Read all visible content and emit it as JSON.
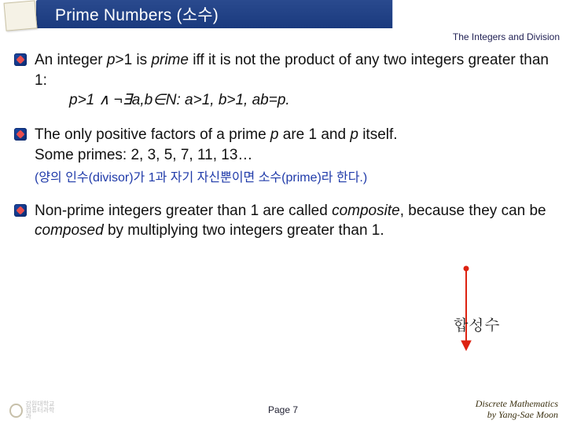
{
  "header": {
    "title": "Prime Numbers (소수)",
    "section": "The Integers and Division"
  },
  "bullets": {
    "b1_l1": "An integer ",
    "b1_var1": "p",
    "b1_l1b": ">1 is ",
    "b1_em": "prime",
    "b1_l1c": " iff it is not the product of any two integers greater than 1:",
    "b1_math": "p>1 ∧ ¬∃a,b∈N: a>1, b>1, ab=p.",
    "b2_l1": "The only positive factors of a prime ",
    "b2_var1": "p",
    "b2_l1b": " are 1 and ",
    "b2_var2": "p",
    "b2_l1c": " itself.",
    "b2_l2": "Some primes: 2, 3, 5, 7, 11, 13…",
    "b2_note": "(양의 인수(divisor)가 1과 자기 자신뿐이면 소수(prime)라 한다.)",
    "b3_l1": "Non-prime integers greater than 1 are called ",
    "b3_em": "composite",
    "b3_l1b": ", because they can be ",
    "b3_em2": "composed",
    "b3_l1c": " by multiplying two integers greater than 1."
  },
  "annotation": "합성수",
  "footer": {
    "page": "Page 7",
    "course_line1": "Discrete Mathematics",
    "course_line2": "by Yang-Sae Moon"
  }
}
